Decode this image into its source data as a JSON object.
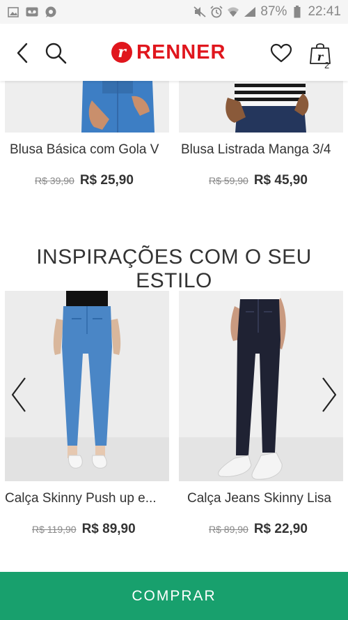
{
  "status_bar": {
    "battery": "87%",
    "time": "22:41",
    "left_icons": [
      "image-icon",
      "voicemail-icon",
      "whatsapp-icon"
    ],
    "right_icons": [
      "mute-icon",
      "alarm-icon",
      "wifi-icon",
      "signal-icon",
      "battery-icon"
    ]
  },
  "header": {
    "logo_letter": "r",
    "logo_text": "RENNER",
    "bag_count": "2"
  },
  "top_products": [
    {
      "name": "Blusa Básica com Gola V",
      "old_price": "R$ 39,90",
      "price": "R$ 25,90"
    },
    {
      "name": "Blusa Listrada Manga 3/4",
      "old_price": "R$ 59,90",
      "price": "R$ 45,90"
    }
  ],
  "section": {
    "title": "INSPIRAÇÕES COM O SEU ESTILO"
  },
  "inspiration_products": [
    {
      "name": "Calça Skinny Push up e...",
      "old_price": "R$ 119,90",
      "price": "R$ 89,90"
    },
    {
      "name": "Calça Jeans Skinny Lisa",
      "old_price": "R$ 89,90",
      "price": "R$ 22,90"
    }
  ],
  "buy_button": {
    "label": "COMPRAR"
  },
  "colors": {
    "brand_red": "#e0161d",
    "buy_green": "#18a06d",
    "light_denim": "#4a86c6",
    "dark_denim": "#1f2233"
  }
}
